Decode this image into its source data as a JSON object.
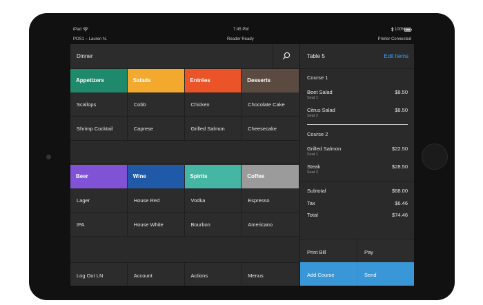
{
  "status": {
    "device": "iPad",
    "time": "7:45 PM",
    "battery": "100%"
  },
  "pos": {
    "station": "POS1 – Lauren N.",
    "reader": "Reader Ready",
    "printer": "Printer Connected"
  },
  "menu": {
    "title": "Dinner"
  },
  "categories_top": [
    {
      "label": "Appetizers",
      "color": "#1e8a6b"
    },
    {
      "label": "Salads",
      "color": "#f3a92e"
    },
    {
      "label": "Entrées",
      "color": "#ea5428"
    },
    {
      "label": "Desserts",
      "color": "#5b4a40"
    }
  ],
  "items_top": [
    [
      "Scallops",
      "Cobb",
      "Chicken",
      "Chocolate Cake"
    ],
    [
      "Shrimp Cocktail",
      "Caprese",
      "Grilled Salmon",
      "Cheesecake"
    ]
  ],
  "categories_bottom": [
    {
      "label": "Beer",
      "color": "#7f52d6"
    },
    {
      "label": "Wine",
      "color": "#1f59a8"
    },
    {
      "label": "Spirits",
      "color": "#45b5a4"
    },
    {
      "label": "Coffee",
      "color": "#9b9b9b"
    }
  ],
  "items_bottom": [
    [
      "Lager",
      "House Red",
      "Vodka",
      "Espresso"
    ],
    [
      "IPA",
      "House White",
      "Bourbon",
      "Americano"
    ]
  ],
  "bottom_bar": [
    "Log Out LN",
    "Account",
    "Actions",
    "Menus"
  ],
  "ticket": {
    "table": "Table 5",
    "edit": "Edit Items",
    "course1": {
      "label": "Course 1",
      "lines": [
        {
          "name": "Beet Salad",
          "seat": "Seat 1",
          "price": "$8.50"
        },
        {
          "name": "Citrus Salad",
          "seat": "Seat 2",
          "price": "$8.50"
        }
      ]
    },
    "course2": {
      "label": "Course 2",
      "lines": [
        {
          "name": "Grilled Salmon",
          "seat": "Seat 1",
          "price": "$22.50"
        },
        {
          "name": "Steak",
          "seat": "Seat 2",
          "price": "$28.50"
        }
      ]
    },
    "subtotal_label": "Subtotal",
    "subtotal": "$68.00",
    "tax_label": "Tax",
    "tax": "$6.46",
    "total_label": "Total",
    "total": "$74.46",
    "print_bill": "Print Bill",
    "pay": "Pay",
    "add_course": "Add Course",
    "send": "Send"
  },
  "icons": {
    "search": "search-icon",
    "wifi": "wifi-icon",
    "battery": "battery-icon",
    "bluetooth": "bluetooth-icon"
  }
}
